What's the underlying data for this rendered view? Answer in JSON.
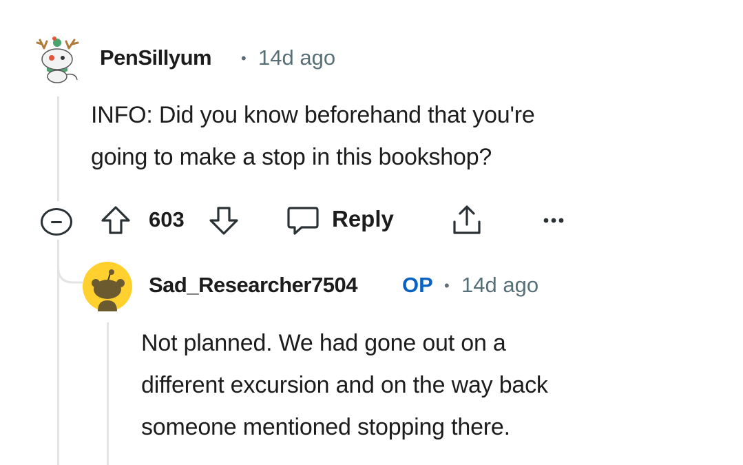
{
  "comments": [
    {
      "username": "PenSillyum",
      "separator": "•",
      "time": "14d ago",
      "avatar_icon": "snoo-reindeer-avatar-icon",
      "body_lines": [
        "INFO: Did you know beforehand that you're",
        "going to make a stop in this bookshop?"
      ],
      "actions": {
        "collapse_icon": "collapse-minus-icon",
        "upvote_icon": "upvote-arrow-icon",
        "vote_count": "603",
        "downvote_icon": "downvote-arrow-icon",
        "reply_icon": "comment-bubble-icon",
        "reply_label": "Reply",
        "share_icon": "share-icon",
        "more_icon": "more-dots-icon"
      }
    },
    {
      "username": "Sad_Researcher7504",
      "op_badge": "OP",
      "separator": "•",
      "time": "14d ago",
      "avatar_icon": "snoo-default-avatar-icon",
      "body_lines": [
        "Not planned. We had gone out on a",
        "different excursion and on the way back",
        "someone mentioned stopping there."
      ]
    }
  ],
  "colors": {
    "text": "#1c1c1c",
    "meta": "#576f76",
    "op_badge": "#0a62c2",
    "thread_line": "#e4e4e4",
    "avatar_yellow": "#ffd02e"
  }
}
